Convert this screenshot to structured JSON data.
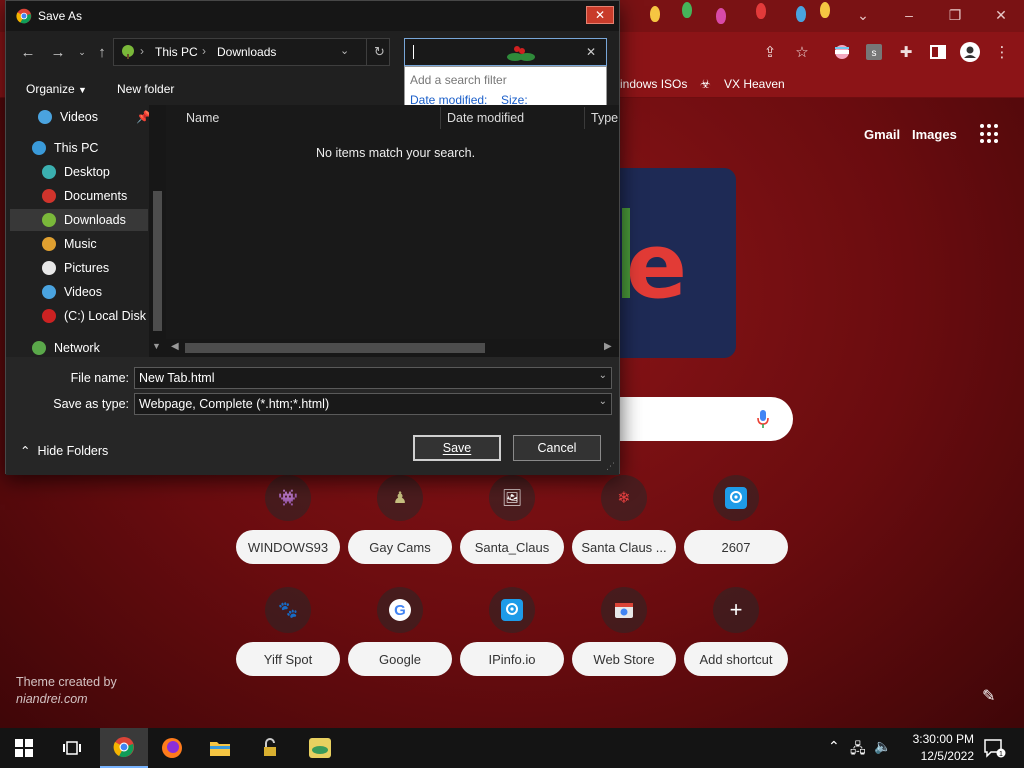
{
  "chrome": {
    "bookmarks": [
      "indows ISOs",
      "VX Heaven"
    ],
    "header_links": [
      "Gmail",
      "Images"
    ],
    "shortcuts_row1": [
      "WINDOWS93",
      "Gay Cams",
      "Santa_Claus",
      "Santa Claus ...",
      "2607"
    ],
    "shortcuts_row2": [
      "Yiff Spot",
      "Google",
      "IPinfo.io",
      "Web Store",
      "Add shortcut"
    ],
    "theme_credit_line1": "Theme created by",
    "theme_credit_line2": "niandrei.com"
  },
  "dialog": {
    "title": "Save As",
    "breadcrumb": [
      "This PC",
      "Downloads"
    ],
    "search_popup": {
      "hint": "Add a search filter",
      "filters": [
        "Date modified:",
        "Size:"
      ]
    },
    "organize_label": "Organize",
    "new_folder_label": "New folder",
    "nav_items": [
      {
        "label": "Videos",
        "icon": "videos-icon",
        "color": "#4aa3df"
      },
      {
        "label": "This PC",
        "icon": "computer-icon",
        "color": "#3a9ad9"
      },
      {
        "label": "Desktop",
        "icon": "desktop-icon",
        "color": "#3bb0b0"
      },
      {
        "label": "Documents",
        "icon": "documents-icon",
        "color": "#d0342c"
      },
      {
        "label": "Downloads",
        "icon": "downloads-icon",
        "color": "#7ab83a"
      },
      {
        "label": "Music",
        "icon": "music-icon",
        "color": "#e0a030"
      },
      {
        "label": "Pictures",
        "icon": "pictures-icon",
        "color": "#e8e8e8"
      },
      {
        "label": "Videos",
        "icon": "videos-icon",
        "color": "#4aa3df"
      },
      {
        "label": "(C:) Local Disk",
        "icon": "disk-icon",
        "color": "#cc2222"
      },
      {
        "label": "Network",
        "icon": "network-icon",
        "color": "#5aa84a"
      }
    ],
    "columns": [
      "Name",
      "Date modified",
      "Type"
    ],
    "empty_message": "No items match your search.",
    "file_name_label": "File name:",
    "file_name_value": "New Tab.html",
    "save_type_label": "Save as type:",
    "save_type_value": "Webpage, Complete (*.htm;*.html)",
    "hide_folders_label": "Hide Folders",
    "save_label": "Save",
    "cancel_label": "Cancel"
  },
  "taskbar": {
    "time": "3:30:00 PM",
    "date": "12/5/2022",
    "notification_count": "1"
  },
  "colors": {
    "chrome_red": "#8c1417",
    "dialog_bg": "#202020",
    "accent_blue": "#78a6d8"
  }
}
